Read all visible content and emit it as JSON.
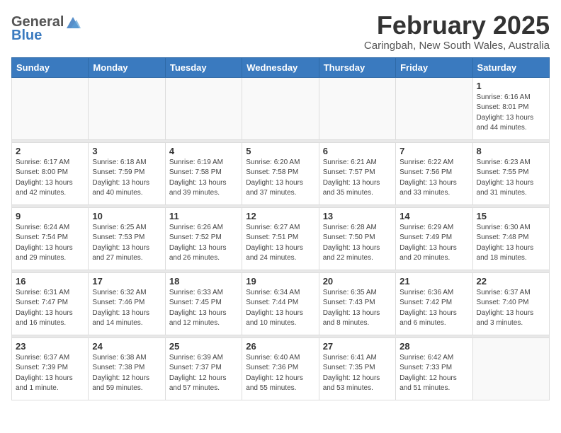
{
  "header": {
    "logo_general": "General",
    "logo_blue": "Blue",
    "title": "February 2025",
    "subtitle": "Caringbah, New South Wales, Australia"
  },
  "days_of_week": [
    "Sunday",
    "Monday",
    "Tuesday",
    "Wednesday",
    "Thursday",
    "Friday",
    "Saturday"
  ],
  "weeks": [
    [
      {
        "date": "",
        "info": ""
      },
      {
        "date": "",
        "info": ""
      },
      {
        "date": "",
        "info": ""
      },
      {
        "date": "",
        "info": ""
      },
      {
        "date": "",
        "info": ""
      },
      {
        "date": "",
        "info": ""
      },
      {
        "date": "1",
        "info": "Sunrise: 6:16 AM\nSunset: 8:01 PM\nDaylight: 13 hours\nand 44 minutes."
      }
    ],
    [
      {
        "date": "2",
        "info": "Sunrise: 6:17 AM\nSunset: 8:00 PM\nDaylight: 13 hours\nand 42 minutes."
      },
      {
        "date": "3",
        "info": "Sunrise: 6:18 AM\nSunset: 7:59 PM\nDaylight: 13 hours\nand 40 minutes."
      },
      {
        "date": "4",
        "info": "Sunrise: 6:19 AM\nSunset: 7:58 PM\nDaylight: 13 hours\nand 39 minutes."
      },
      {
        "date": "5",
        "info": "Sunrise: 6:20 AM\nSunset: 7:58 PM\nDaylight: 13 hours\nand 37 minutes."
      },
      {
        "date": "6",
        "info": "Sunrise: 6:21 AM\nSunset: 7:57 PM\nDaylight: 13 hours\nand 35 minutes."
      },
      {
        "date": "7",
        "info": "Sunrise: 6:22 AM\nSunset: 7:56 PM\nDaylight: 13 hours\nand 33 minutes."
      },
      {
        "date": "8",
        "info": "Sunrise: 6:23 AM\nSunset: 7:55 PM\nDaylight: 13 hours\nand 31 minutes."
      }
    ],
    [
      {
        "date": "9",
        "info": "Sunrise: 6:24 AM\nSunset: 7:54 PM\nDaylight: 13 hours\nand 29 minutes."
      },
      {
        "date": "10",
        "info": "Sunrise: 6:25 AM\nSunset: 7:53 PM\nDaylight: 13 hours\nand 27 minutes."
      },
      {
        "date": "11",
        "info": "Sunrise: 6:26 AM\nSunset: 7:52 PM\nDaylight: 13 hours\nand 26 minutes."
      },
      {
        "date": "12",
        "info": "Sunrise: 6:27 AM\nSunset: 7:51 PM\nDaylight: 13 hours\nand 24 minutes."
      },
      {
        "date": "13",
        "info": "Sunrise: 6:28 AM\nSunset: 7:50 PM\nDaylight: 13 hours\nand 22 minutes."
      },
      {
        "date": "14",
        "info": "Sunrise: 6:29 AM\nSunset: 7:49 PM\nDaylight: 13 hours\nand 20 minutes."
      },
      {
        "date": "15",
        "info": "Sunrise: 6:30 AM\nSunset: 7:48 PM\nDaylight: 13 hours\nand 18 minutes."
      }
    ],
    [
      {
        "date": "16",
        "info": "Sunrise: 6:31 AM\nSunset: 7:47 PM\nDaylight: 13 hours\nand 16 minutes."
      },
      {
        "date": "17",
        "info": "Sunrise: 6:32 AM\nSunset: 7:46 PM\nDaylight: 13 hours\nand 14 minutes."
      },
      {
        "date": "18",
        "info": "Sunrise: 6:33 AM\nSunset: 7:45 PM\nDaylight: 13 hours\nand 12 minutes."
      },
      {
        "date": "19",
        "info": "Sunrise: 6:34 AM\nSunset: 7:44 PM\nDaylight: 13 hours\nand 10 minutes."
      },
      {
        "date": "20",
        "info": "Sunrise: 6:35 AM\nSunset: 7:43 PM\nDaylight: 13 hours\nand 8 minutes."
      },
      {
        "date": "21",
        "info": "Sunrise: 6:36 AM\nSunset: 7:42 PM\nDaylight: 13 hours\nand 6 minutes."
      },
      {
        "date": "22",
        "info": "Sunrise: 6:37 AM\nSunset: 7:40 PM\nDaylight: 13 hours\nand 3 minutes."
      }
    ],
    [
      {
        "date": "23",
        "info": "Sunrise: 6:37 AM\nSunset: 7:39 PM\nDaylight: 13 hours\nand 1 minute."
      },
      {
        "date": "24",
        "info": "Sunrise: 6:38 AM\nSunset: 7:38 PM\nDaylight: 12 hours\nand 59 minutes."
      },
      {
        "date": "25",
        "info": "Sunrise: 6:39 AM\nSunset: 7:37 PM\nDaylight: 12 hours\nand 57 minutes."
      },
      {
        "date": "26",
        "info": "Sunrise: 6:40 AM\nSunset: 7:36 PM\nDaylight: 12 hours\nand 55 minutes."
      },
      {
        "date": "27",
        "info": "Sunrise: 6:41 AM\nSunset: 7:35 PM\nDaylight: 12 hours\nand 53 minutes."
      },
      {
        "date": "28",
        "info": "Sunrise: 6:42 AM\nSunset: 7:33 PM\nDaylight: 12 hours\nand 51 minutes."
      },
      {
        "date": "",
        "info": ""
      }
    ]
  ]
}
